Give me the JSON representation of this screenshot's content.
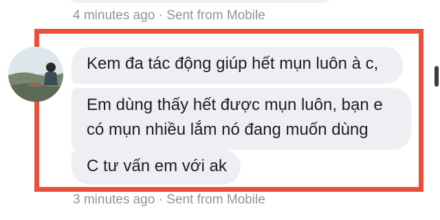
{
  "meta": {
    "previous": "4 minutes ago · Sent from Mobile",
    "next": "3 minutes ago · Sent from Mobile"
  },
  "messages": [
    {
      "lines": [
        "Kem đa tác động giúp hết mụn luôn à c,"
      ]
    },
    {
      "lines": [
        "Em dùng thấy hết được mụn luôn, bạn e",
        "có mụn nhiều lắm nó đang muốn dùng"
      ]
    },
    {
      "lines": [
        "C tư vấn em với ak"
      ]
    }
  ],
  "colors": {
    "bubble": "#eeeff2",
    "highlight": "#e8503a",
    "meta_text": "#8d949e"
  },
  "icons": {
    "avatar": "user-avatar"
  }
}
